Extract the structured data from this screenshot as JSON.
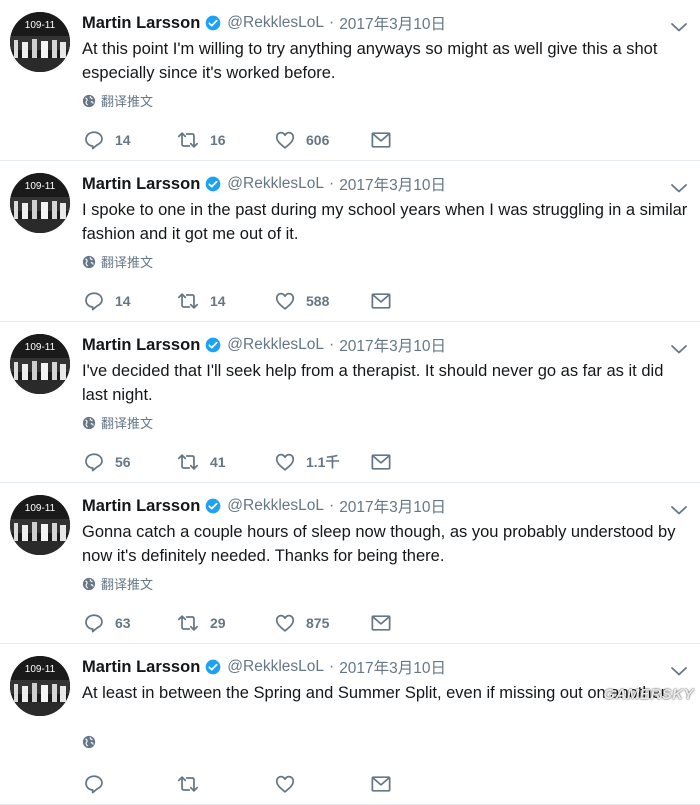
{
  "colors": {
    "text": "#14171a",
    "muted": "#657786",
    "verified": "#1da1f2",
    "divider": "#e6ecf0"
  },
  "avatar_text": "109-11",
  "tweets": [
    {
      "name": "Martin Larsson",
      "handle": "@RekklesLoL",
      "dot": "·",
      "time": "2017年3月10日",
      "text": "At this point I'm willing to try anything anyways so might as well give this a shot especially since it's worked before.",
      "translate": "翻译推文",
      "replies": "14",
      "retweets": "16",
      "likes": "606"
    },
    {
      "name": "Martin Larsson",
      "handle": "@RekklesLoL",
      "dot": "·",
      "time": "2017年3月10日",
      "text": "I spoke to one in the past during my school years when I was struggling in a similar fashion and it got me out of it.",
      "translate": "翻译推文",
      "replies": "14",
      "retweets": "14",
      "likes": "588"
    },
    {
      "name": "Martin Larsson",
      "handle": "@RekklesLoL",
      "dot": "·",
      "time": "2017年3月10日",
      "text": "I've decided that I'll seek help from a therapist. It should never go as far as it did last night.",
      "translate": "翻译推文",
      "replies": "56",
      "retweets": "41",
      "likes": "1.1千"
    },
    {
      "name": "Martin Larsson",
      "handle": "@RekklesLoL",
      "dot": "·",
      "time": "2017年3月10日",
      "text": "Gonna catch a couple hours of sleep now though, as you probably understood by now it's definitely needed. Thanks for being there.",
      "translate": "翻译推文",
      "replies": "63",
      "retweets": "29",
      "likes": "875"
    },
    {
      "name": "Martin Larsson",
      "handle": "@RekklesLoL",
      "dot": "·",
      "time": "2017年3月10日",
      "text": "At least in between the Spring and Summer Split, even if missing out on another",
      "translate": "",
      "replies": "",
      "retweets": "",
      "likes": ""
    }
  ],
  "watermark": "GAMERSKY"
}
